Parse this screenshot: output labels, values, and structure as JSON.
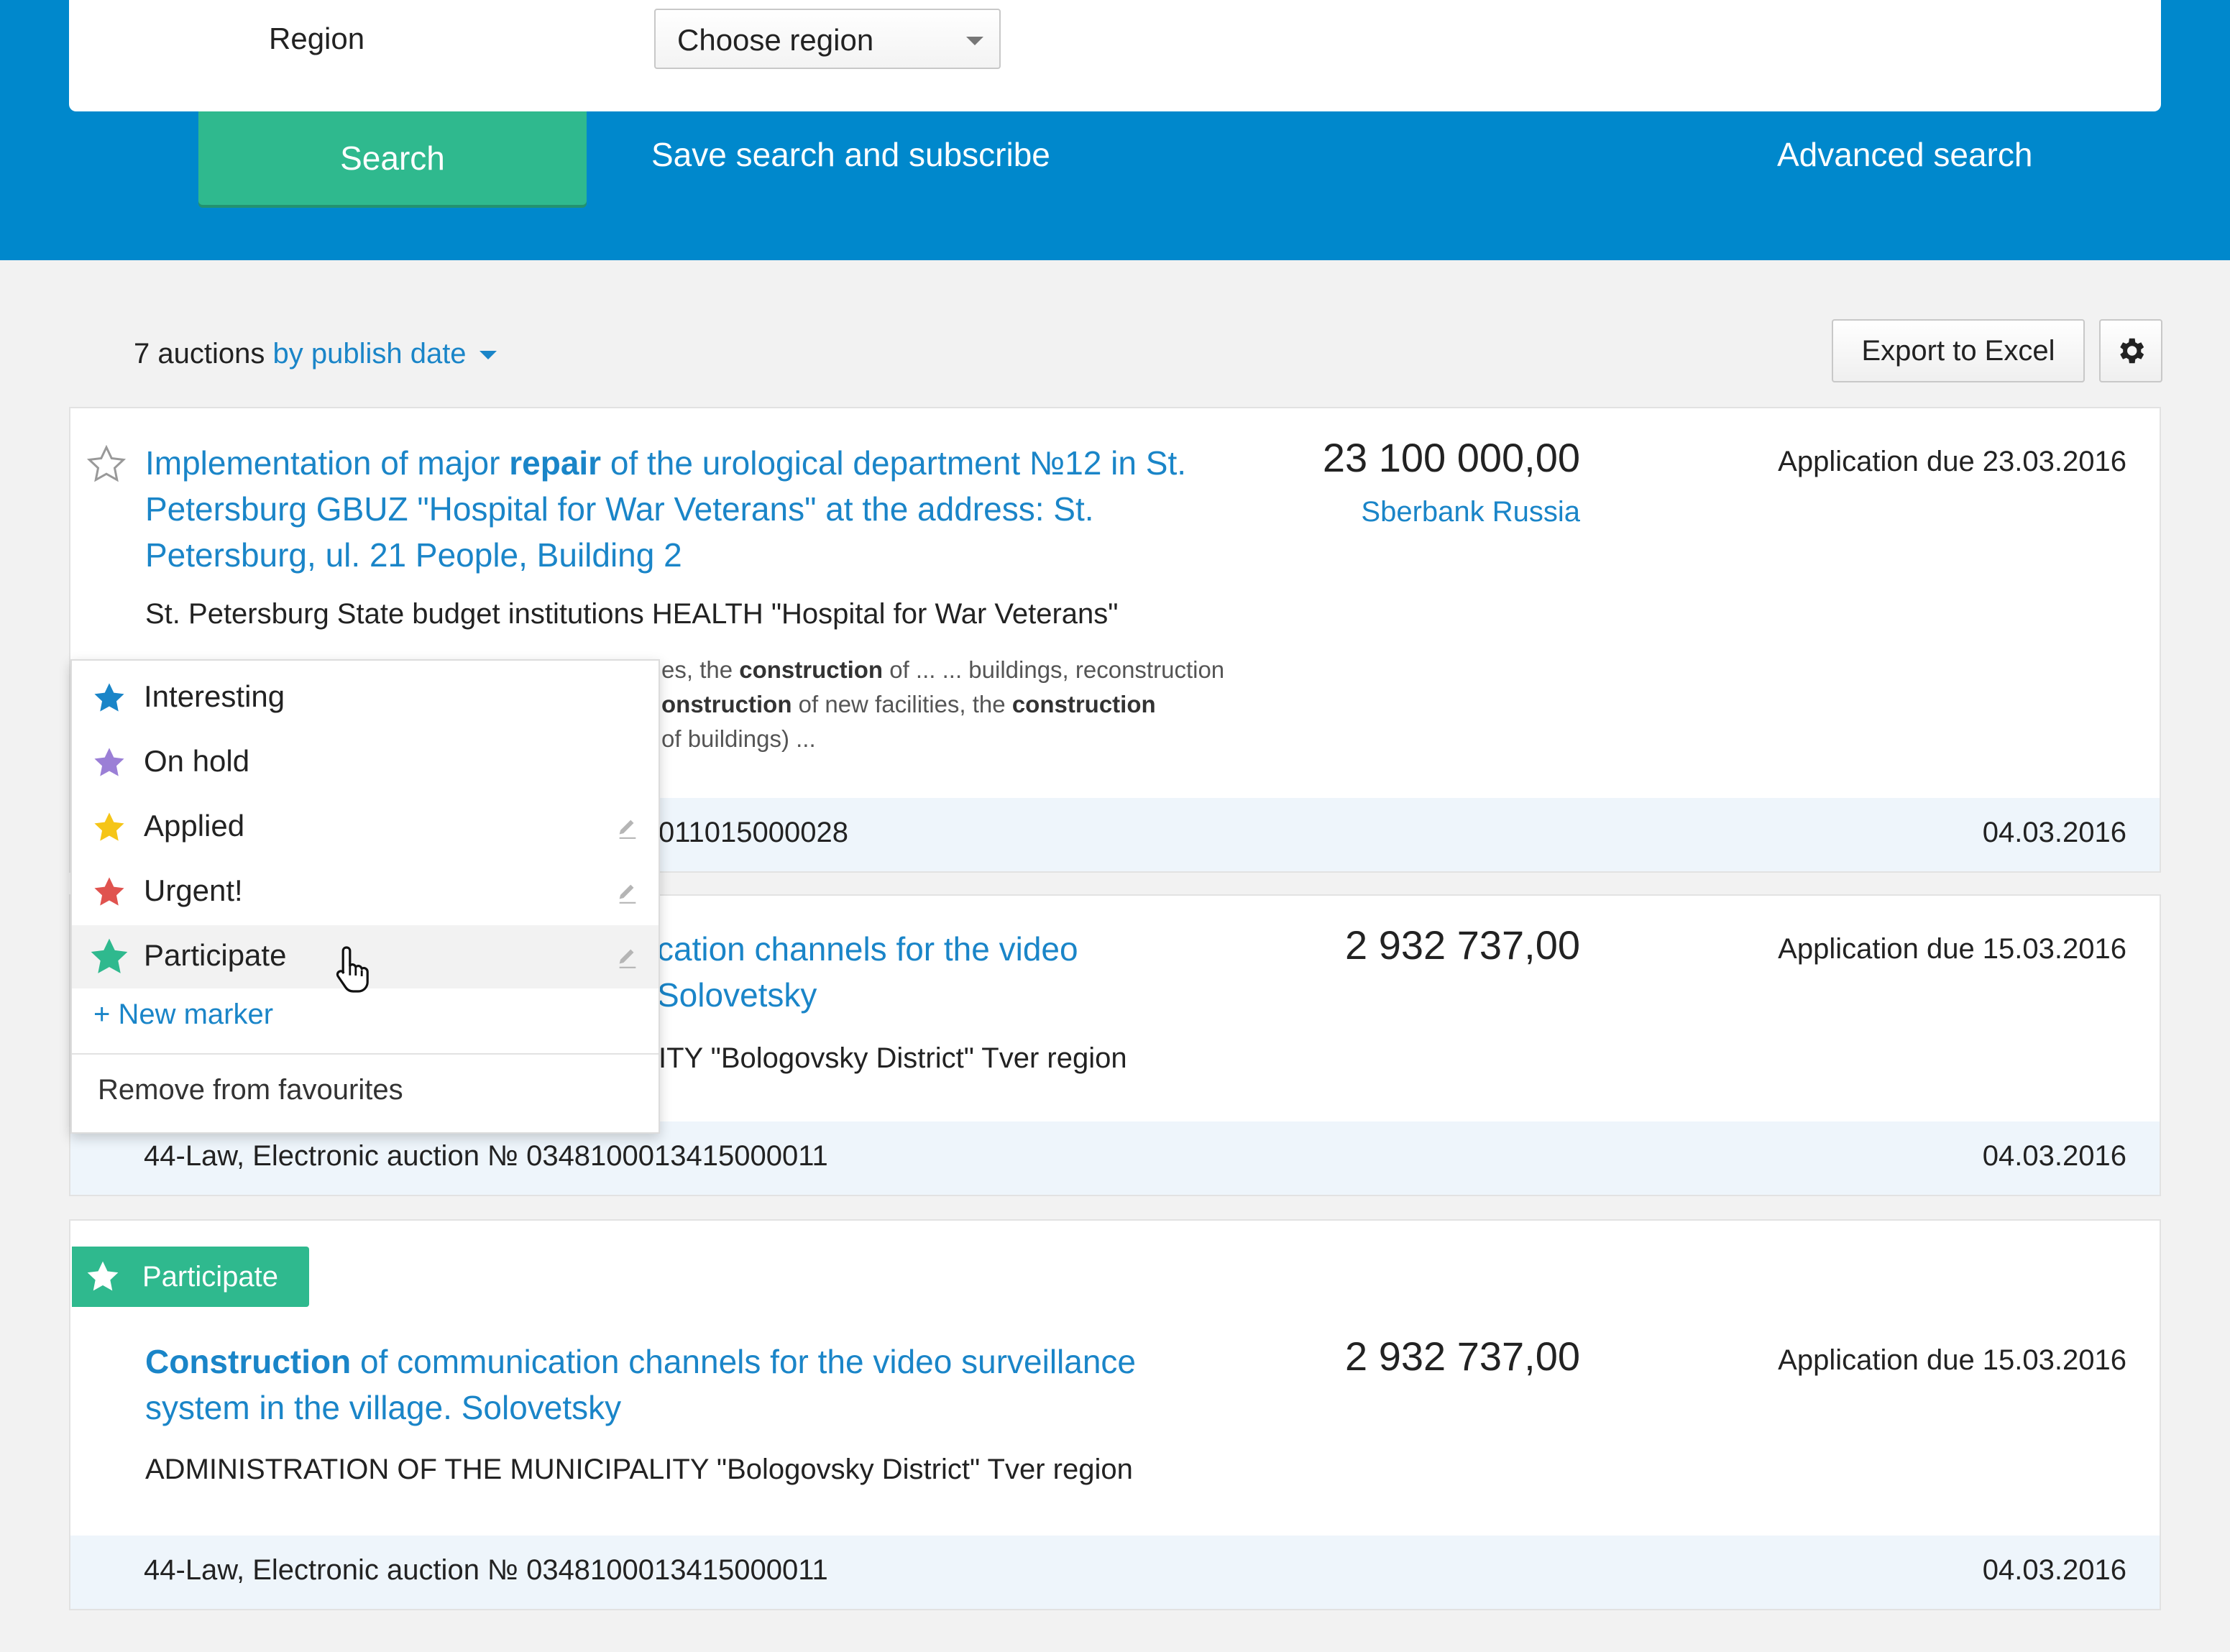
{
  "filter": {
    "region_label": "Region",
    "region_value": "Choose region",
    "search_button": "Search",
    "save_search": "Save search and subscribe",
    "advanced_search": "Advanced search"
  },
  "results_bar": {
    "count": "7 auctions",
    "sort": "by publish date",
    "export_button": "Export to Excel",
    "settings_icon": "gear-icon"
  },
  "auctions": [
    {
      "title_a": "Implementation of major ",
      "title_b": "repair",
      "title_c": " of the urological department №12 in St.",
      "title_line2": "Petersburg GBUZ \"Hospital for War Veterans\" at the address: St.",
      "title_line3": "Petersburg, ul. 21 People, Building 2",
      "org": "St. Petersburg State budget institutions HEALTH \"Hospital for War Veterans\"",
      "snippet_l1_a": "es, the ",
      "snippet_l1_b": "construction",
      "snippet_l1_c": " of ... ... buildings, reconstruction",
      "snippet_l2_a": "onstruction",
      "snippet_l2_b": " of new facilities, the ",
      "snippet_l2_c": "construction",
      "snippet_l3": "of buildings) ...",
      "price": "23 100 000,00",
      "bank": "Sberbank Russia",
      "due": "Application due 23.03.2016",
      "footer_left": "011015000028",
      "footer_date": "04.03.2016"
    },
    {
      "title_line1": "cation channels for the video",
      "title_line2": "Solovetsky",
      "org": "ITY \"Bologovsky District\" Tver region",
      "price": "2 932 737,00",
      "due": "Application due 15.03.2016",
      "footer_left": "44-Law, Electronic auction № 0348100013415000011",
      "footer_date": "04.03.2016"
    },
    {
      "badge": "Participate",
      "title_a": "Construction",
      "title_b": " of communication channels for the video surveillance",
      "title_line2": "system in the village. Solovetsky",
      "org": "ADMINISTRATION OF THE MUNICIPALITY \"Bologovsky District\" Tver region",
      "price": "2 932 737,00",
      "due": "Application due 15.03.2016",
      "footer_left": "44-Law, Electronic auction № 0348100013415000011",
      "footer_date": "04.03.2016"
    }
  ],
  "marker_menu": {
    "items": [
      {
        "label": "Interesting",
        "color": "#1a85c8",
        "editable": false
      },
      {
        "label": "On hold",
        "color": "#9b7fd6",
        "editable": false
      },
      {
        "label": "Applied",
        "color": "#f5c518",
        "editable": true
      },
      {
        "label": "Urgent!",
        "color": "#e0534f",
        "editable": true
      },
      {
        "label": "Participate",
        "color": "#2fb98e",
        "editable": true,
        "active": true
      }
    ],
    "new_marker": "+ New marker",
    "remove": "Remove from favourites"
  },
  "colors": {
    "header_blue": "#0088cc",
    "accent_green": "#2fb98e",
    "link_blue": "#1a85c8"
  }
}
